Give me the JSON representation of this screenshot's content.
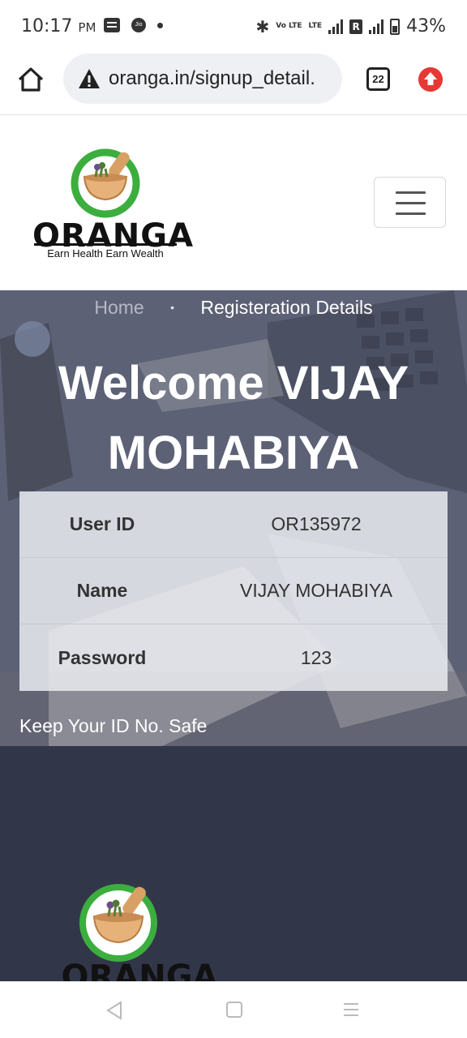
{
  "status_bar": {
    "time": "10:17",
    "ampm": "PM",
    "jio_label": "Jio",
    "volte1": "Vo LTE",
    "lte2": "LTE",
    "roaming": "R",
    "battery": "43%"
  },
  "browser": {
    "url": "oranga.in/signup_detail.",
    "tab_count": "22"
  },
  "site": {
    "brand": "ORANGA",
    "tagline": "Earn Health Earn Wealth"
  },
  "breadcrumb": {
    "home": "Home",
    "separator": "•",
    "current": "Registeration Details"
  },
  "hero": {
    "welcome": "Welcome VIJAY MOHABIYA",
    "note": "Keep Your ID No. Safe"
  },
  "details": [
    {
      "label": "User ID",
      "value": "OR135972"
    },
    {
      "label": "Name",
      "value": "VIJAY MOHABIYA"
    },
    {
      "label": "Password",
      "value": "123"
    }
  ],
  "footer": {
    "brand": "ORANGA"
  },
  "colors": {
    "logo_ring": "#3cae3e",
    "footer_bg": "#323649",
    "update_icon": "#e53935"
  }
}
